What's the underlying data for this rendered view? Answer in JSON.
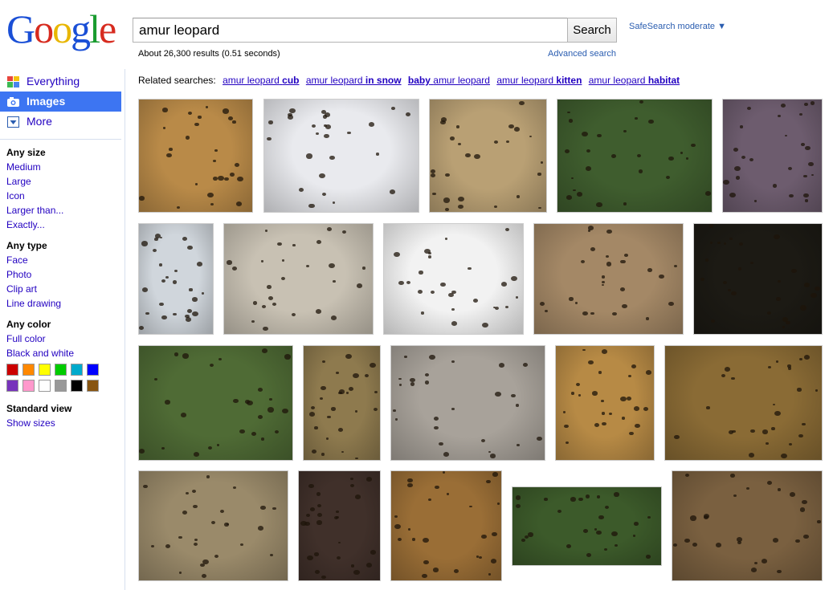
{
  "logo": {
    "text": "Google"
  },
  "search": {
    "query": "amur leopard",
    "button_label": "Search"
  },
  "safesearch": "SafeSearch moderate ▼",
  "results_stats": "About 26,300 results (0.51 seconds)",
  "advanced_search": "Advanced search",
  "nav": {
    "everything": "Everything",
    "images": "Images",
    "more": "More"
  },
  "filters": {
    "size_head": "Any size",
    "size_items": [
      "Medium",
      "Large",
      "Icon",
      "Larger than...",
      "Exactly..."
    ],
    "type_head": "Any type",
    "type_items": [
      "Face",
      "Photo",
      "Clip art",
      "Line drawing"
    ],
    "color_head": "Any color",
    "color_items": [
      "Full color",
      "Black and white"
    ],
    "color_swatches": [
      "#cc0000",
      "#ff8800",
      "#ffff00",
      "#00cc00",
      "#00aacc",
      "#0000ff",
      "#7733bb",
      "#ff99cc",
      "#ffffff",
      "#999999",
      "#000000",
      "#885511"
    ],
    "view_head": "Standard view",
    "view_items": [
      "Show sizes"
    ]
  },
  "related": {
    "label": "Related searches:",
    "items": [
      {
        "normal": "amur leopard",
        "bold": "cub"
      },
      {
        "normal": "amur leopard",
        "bold": "in snow"
      },
      {
        "bold_first": "baby",
        "normal": "amur leopard"
      },
      {
        "normal": "amur leopard",
        "bold": "kitten"
      },
      {
        "normal": "amur leopard",
        "bold": "habitat"
      }
    ]
  },
  "image_tones": {
    "r1c1": "#b98a48",
    "r1c2": "#e9eaee",
    "r1c3": "#b9a074",
    "r1c4": "#3f5d2e",
    "r1c5": "#6d5c6e",
    "r2c1": "#d0d6dc",
    "r2c2": "#c8c1b3",
    "r2c3": "#f2f2f2",
    "r2c4": "#a48866",
    "r2c5": "#1c1a14",
    "r3c1": "#4f6b35",
    "r3c2": "#8e7a4e",
    "r3c3": "#a8a29a",
    "r3c4": "#b78a45",
    "r3c5": "#8a6b35",
    "r4c1": "#9a8a6a",
    "r4c2": "#40302a",
    "r4c3": "#9a6e36",
    "r4c4": "#3c5a2a",
    "r4c5": "#7a6040"
  }
}
